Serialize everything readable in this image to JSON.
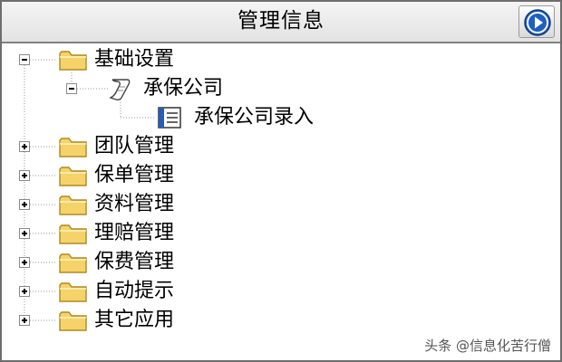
{
  "header": {
    "title": "管理信息",
    "nav_icon": "play-circle-icon"
  },
  "tree": {
    "root_items": [
      {
        "label": "基础设置",
        "icon": "folder-icon",
        "expanded": true,
        "children": [
          {
            "label": "承保公司",
            "icon": "scroll-icon",
            "expanded": true,
            "children": [
              {
                "label": "承保公司录入",
                "icon": "form-icon"
              }
            ]
          }
        ]
      },
      {
        "label": "团队管理",
        "icon": "folder-icon",
        "expanded": false
      },
      {
        "label": "保单管理",
        "icon": "folder-icon",
        "expanded": false
      },
      {
        "label": "资料管理",
        "icon": "folder-icon",
        "expanded": false
      },
      {
        "label": "理赔管理",
        "icon": "folder-icon",
        "expanded": false
      },
      {
        "label": "保费管理",
        "icon": "folder-icon",
        "expanded": false
      },
      {
        "label": "自动提示",
        "icon": "folder-icon",
        "expanded": false
      },
      {
        "label": "其它应用",
        "icon": "folder-icon",
        "expanded": false
      }
    ]
  },
  "watermark": "头条 @信息化苦行僧",
  "colors": {
    "folder": "#f5d36a",
    "folder_outline": "#b08a1e",
    "nav_blue": "#1e5fbf",
    "tree_line": "#9a9a9a"
  }
}
